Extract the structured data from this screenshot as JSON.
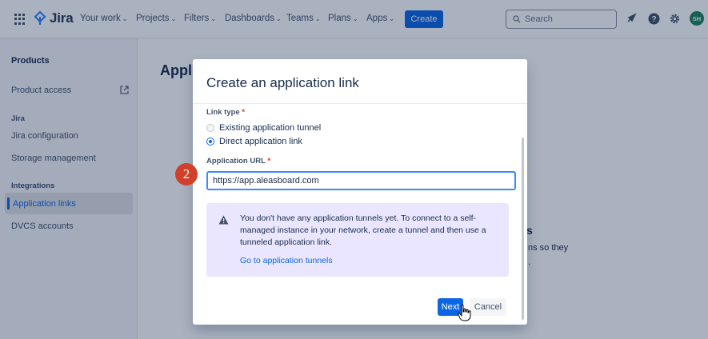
{
  "topnav": {
    "logo_text": "Jira",
    "items": [
      {
        "label": "Your work"
      },
      {
        "label": "Projects"
      },
      {
        "label": "Filters"
      },
      {
        "label": "Dashboards"
      },
      {
        "label": "Teams"
      },
      {
        "label": "Plans"
      },
      {
        "label": "Apps"
      }
    ],
    "create_label": "Create",
    "search_placeholder": "Search",
    "icons": [
      "notifications-icon",
      "help-icon",
      "settings-icon"
    ],
    "avatar_initials": "SH"
  },
  "sidebar": {
    "heading": "Products",
    "product_access": "Product access",
    "jira_section": "Jira",
    "jira_configuration": "Jira configuration",
    "storage_management": "Storage management",
    "integrations_section": "Integrations",
    "application_links": "Application links",
    "dvcs_accounts": "DVCS accounts"
  },
  "main": {
    "page_title_fragment": "Applic",
    "bg_fragment_1": "s",
    "bg_fragment_2": "ns so they",
    "bg_fragment_3": "."
  },
  "modal": {
    "title": "Create an application link",
    "link_type_label": "Link type",
    "required_marker": "*",
    "options": [
      {
        "label": "Existing application tunnel",
        "selected": false
      },
      {
        "label": "Direct application link",
        "selected": true
      }
    ],
    "url_label": "Application URL",
    "url_value": "https://app.aleasboard.com",
    "info_text": "You don't have any application tunnels yet. To connect to a self-managed instance in your network, create a tunnel and then use a tunneled application link.",
    "info_link": "Go to application tunnels",
    "next_label": "Next",
    "cancel_label": "Cancel"
  },
  "step_badge": "2",
  "colors": {
    "primary": "#0c66e4",
    "info_bg": "#eae6ff",
    "badge": "#d0402b",
    "avatar": "#1f845a"
  }
}
